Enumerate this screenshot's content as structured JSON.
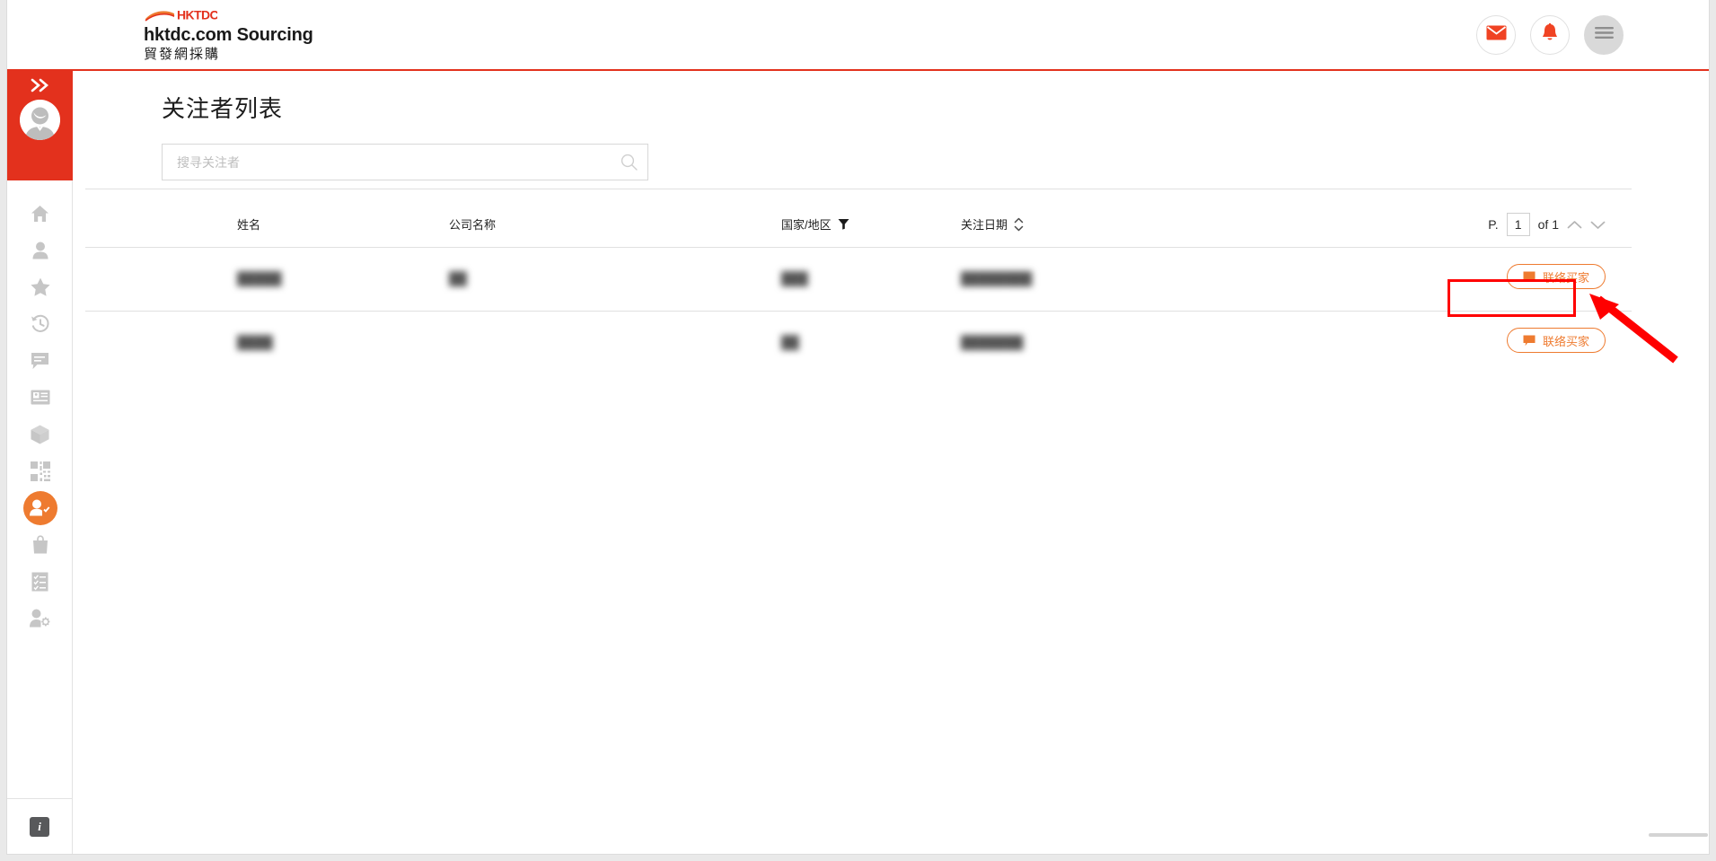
{
  "header": {
    "logo_text": "HKTDC",
    "brand_title": "hktdc.com Sourcing",
    "brand_subtitle": "貿發網採購",
    "actions": [
      {
        "name": "mail-icon",
        "label": ""
      },
      {
        "name": "bell-icon",
        "label": ""
      },
      {
        "name": "hamburger-menu-icon",
        "label": ""
      }
    ],
    "accent_color": "#e3311d"
  },
  "sidebar": {
    "expand_label": "»",
    "active_color": "#ee7b30",
    "header_color": "#e3311d",
    "items": [
      {
        "icon": "home-icon",
        "label": "Home",
        "active": false
      },
      {
        "icon": "person-icon",
        "label": "Profile",
        "active": false
      },
      {
        "icon": "star-icon",
        "label": "Favourites",
        "active": false
      },
      {
        "icon": "history-icon",
        "label": "History",
        "active": false
      },
      {
        "icon": "chat-icon",
        "label": "Messages",
        "active": false
      },
      {
        "icon": "card-icon",
        "label": "Cards",
        "active": false
      },
      {
        "icon": "box-icon",
        "label": "Products",
        "active": false
      },
      {
        "icon": "qr-code-icon",
        "label": "QR Code",
        "active": false
      },
      {
        "icon": "person-check-icon",
        "label": "Followers",
        "active": true
      },
      {
        "icon": "bag-icon",
        "label": "Orders",
        "active": false
      },
      {
        "icon": "checklist-icon",
        "label": "Tasks",
        "active": false
      },
      {
        "icon": "person-gear-icon",
        "label": "Settings",
        "active": false
      }
    ],
    "info_label": "i"
  },
  "main": {
    "page_title": "关注者列表",
    "search": {
      "placeholder": "搜寻关注者",
      "value": ""
    },
    "table": {
      "columns": [
        {
          "key": "name",
          "label": "姓名"
        },
        {
          "key": "company",
          "label": "公司名称"
        },
        {
          "key": "country",
          "label": "国家/地区"
        },
        {
          "key": "date",
          "label": "关注日期"
        }
      ],
      "rows": [
        {
          "name": "█████",
          "company": "██",
          "country": "███",
          "date": "████████",
          "action_label": "联络买家"
        },
        {
          "name": "████",
          "company": "",
          "country": "██",
          "date": "███████",
          "action_label": "联络买家"
        }
      ]
    },
    "pagination": {
      "prefix": "P.",
      "page": "1",
      "suffix": "of 1"
    }
  },
  "annotation": {
    "color": "#ff0000",
    "target": "contact-buyer-button-row-1"
  }
}
